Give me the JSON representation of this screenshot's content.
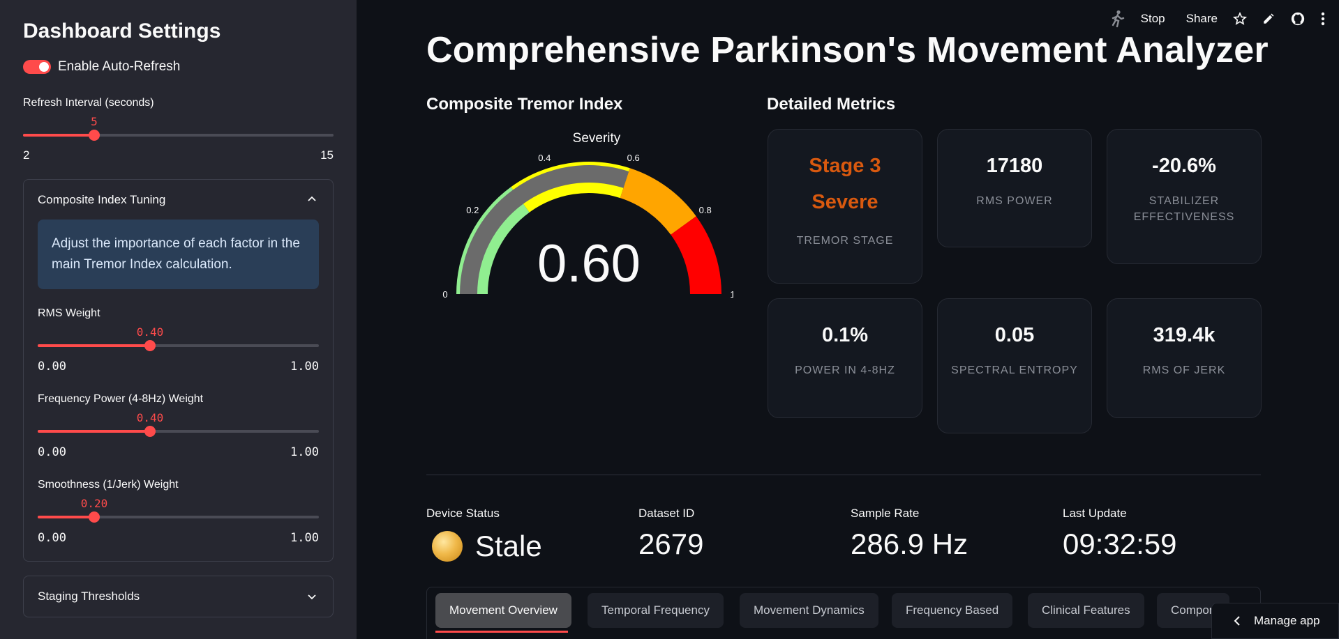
{
  "sidebar": {
    "title": "Dashboard Settings",
    "auto_refresh_label": "Enable Auto-Refresh",
    "refresh_interval": {
      "label": "Refresh Interval (seconds)",
      "value": "5",
      "min": "2",
      "max": "15",
      "fraction": 0.23
    },
    "composite_expander": {
      "title": "Composite Index Tuning",
      "info": "Adjust the importance of each factor in the main Tremor Index calculation.",
      "sliders": [
        {
          "label": "RMS Weight",
          "value": "0.40",
          "min": "0.00",
          "max": "1.00",
          "fraction": 0.4
        },
        {
          "label": "Frequency Power (4-8Hz) Weight",
          "value": "0.40",
          "min": "0.00",
          "max": "1.00",
          "fraction": 0.4
        },
        {
          "label": "Smoothness (1/Jerk) Weight",
          "value": "0.20",
          "min": "0.00",
          "max": "1.00",
          "fraction": 0.2
        }
      ]
    },
    "staging_expander": {
      "title": "Staging Thresholds"
    }
  },
  "topbar": {
    "stop": "Stop",
    "share": "Share"
  },
  "page_title": "Comprehensive Parkinson's Movement Analyzer",
  "gauge": {
    "section_title": "Composite Tremor Index",
    "title": "Severity",
    "value": 0.6,
    "value_text": "0.60",
    "ticks": [
      "0",
      "0.2",
      "0.4",
      "0.6",
      "0.8",
      "1"
    ],
    "bands": [
      {
        "from": 0,
        "to": 0.3,
        "color": "#90ee90"
      },
      {
        "from": 0.3,
        "to": 0.6,
        "color": "#ffff00"
      },
      {
        "from": 0.6,
        "to": 0.8,
        "color": "#ffa500"
      },
      {
        "from": 0.8,
        "to": 1.0,
        "color": "#ff0000"
      }
    ],
    "bar_color": "#6b6b6b"
  },
  "metrics": {
    "section_title": "Detailed Metrics",
    "tremor_stage": {
      "line1": "Stage 3",
      "line2": "Severe",
      "label": "TREMOR STAGE"
    },
    "rms_power": {
      "value": "17180",
      "label": "RMS POWER"
    },
    "stabilizer": {
      "value": "-20.6%",
      "label_line1": "STABILIZER",
      "label_line2": "EFFECTIVENESS"
    },
    "power_band": {
      "value": "0.1%",
      "label": "POWER IN 4-8HZ"
    },
    "spectral_entropy": {
      "value": "0.05",
      "label": "SPECTRAL ENTROPY"
    },
    "rms_jerk": {
      "value": "319.4k",
      "label": "RMS OF JERK"
    }
  },
  "status": {
    "device_status": {
      "label": "Device Status",
      "value": "Stale"
    },
    "dataset_id": {
      "label": "Dataset ID",
      "value": "2679"
    },
    "sample_rate": {
      "label": "Sample Rate",
      "value": "286.9 Hz"
    },
    "last_update": {
      "label": "Last Update",
      "value": "09:32:59"
    }
  },
  "tabs": [
    "Movement Overview",
    "Temporal Frequency",
    "Movement Dynamics",
    "Frequency Based",
    "Clinical Features",
    "Compon"
  ],
  "manage_app": "Manage app",
  "colors": {
    "accent": "#ff4b4b",
    "stage": "#d9590f",
    "sidebar_bg": "#262730",
    "main_bg": "#0e1117"
  }
}
